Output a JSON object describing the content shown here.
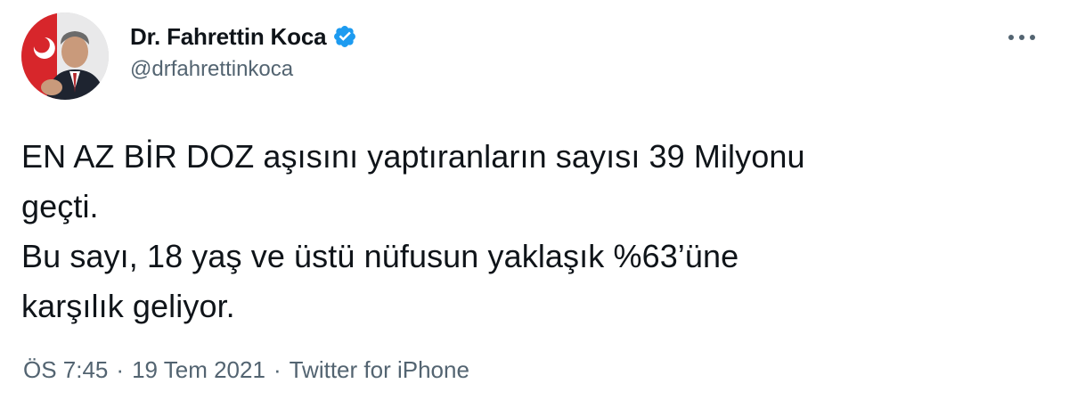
{
  "author": {
    "display_name": "Dr. Fahrettin Koca",
    "handle": "@drfahrettinkoca",
    "verified_icon": "verified-badge-icon",
    "avatar_icon": "profile-photo"
  },
  "tweet": {
    "lines": [
      "EN AZ BİR DOZ aşısını yaptıranların sayısı 39 Milyonu",
      "geçti.",
      "Bu sayı, 18 yaş ve üstü nüfusun yaklaşık %63’üne",
      "karşılık geliyor."
    ]
  },
  "meta": {
    "time": "ÖS 7:45",
    "separator": "·",
    "date": "19 Tem 2021",
    "source": "Twitter for iPhone"
  },
  "menu": {
    "more_icon": "more-options-icon"
  },
  "colors": {
    "text_primary": "#0f1419",
    "text_secondary": "#536471",
    "verified_blue": "#1d9bf0"
  }
}
